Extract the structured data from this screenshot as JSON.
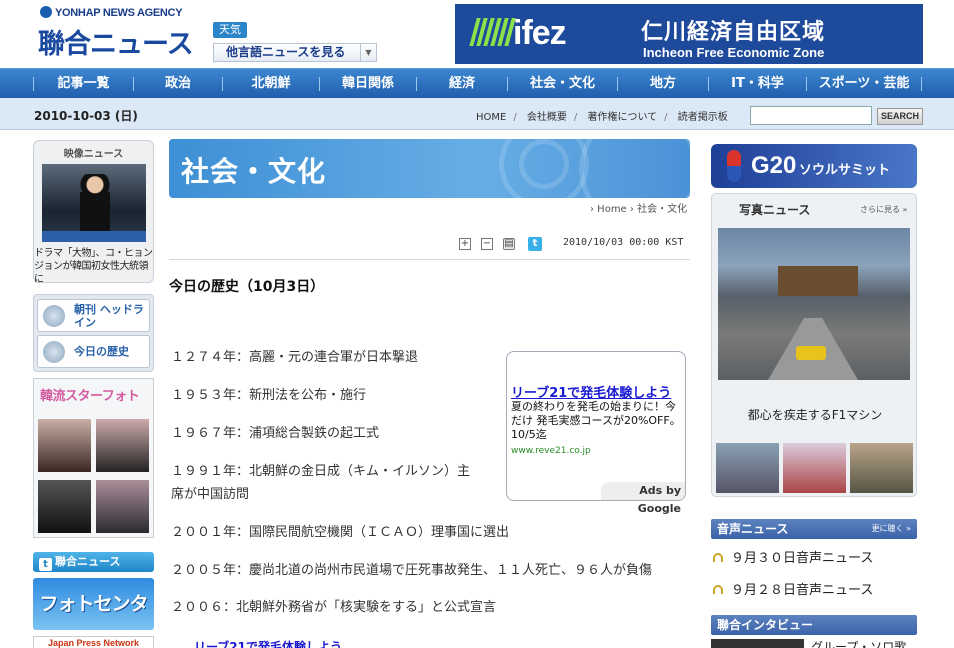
{
  "header": {
    "agency": "YONHAP NEWS AGENCY",
    "logo": "聯合ニュース",
    "weather": "天気",
    "lang_select": "他言語ニュースを見る",
    "banner": {
      "brand": "ifez",
      "ja": "仁川経済自由区域",
      "en": "Incheon Free Economic Zone"
    }
  },
  "nav": [
    "記事一覧",
    "政治",
    "北朝鮮",
    "韓日関係",
    "経済",
    "社会・文化",
    "地方",
    "IT・科学",
    "スポーツ・芸能"
  ],
  "subbar": {
    "date": "2010-10-03 (日)",
    "links": [
      "HOME",
      "会社概要",
      "著作権について",
      "読者掲示板"
    ],
    "search_button": "SEARCH"
  },
  "left": {
    "video_title": "映像ニュース",
    "video_caption": "ドラマ「大物」、コ・ヒョンジョンが韓国初女性大統領に",
    "menu": [
      "朝刊 ヘッドライン",
      "今日の歴史"
    ],
    "star_title": "韓流スターフォト",
    "twitter": "聯合ニュースTwitter",
    "photo_center": "フォトセンター",
    "jpn": "Japan Press Network"
  },
  "main": {
    "section": "社会・文化",
    "breadcrumb": "› Home › 社会・文化",
    "timestamp": "2010/10/03 00:00 KST",
    "title": "今日の歴史（10月3日）",
    "history": [
      "１２７４年：高麗・元の連合軍が日本撃退",
      "１９５３年：新刑法を公布・施行",
      "１９６７年：浦項総合製鉄の起工式",
      "１９９１年：北朝鮮の金日成（キム・イルソン）主",
      "席が中国訪問",
      "２００１年：国際民間航空機関（ＩＣＡＯ）理事国に選出",
      "２００５年：慶尚北道の尚州市民道場で圧死事故発生、１１人死亡、９６人が負傷",
      "２００６：北朝鮮外務省が「核実験をする」と公式宣言"
    ],
    "ad": {
      "headline": "リーブ21で発毛体験しよう",
      "desc": "夏の終わりを発毛の始まりに！今だけ 発毛実感コースが20%OFF。10/5迄",
      "url": "www.reve21.co.jp",
      "ads_by": "Ads by Google"
    },
    "ad_bottom": "リーブ21で発毛体験しよう"
  },
  "right": {
    "g20": {
      "title": "G20",
      "sub": "ソウルサミット"
    },
    "photo_title": "写真ニュース",
    "photo_more": "さらに見る »",
    "photo_caption": "都心を疾走するF1マシン",
    "audio_title": "音声ニュース",
    "audio_more": "更に聴く »",
    "audio_items": [
      "９月３０日音声ニュース",
      "９月２８日音声ニュース"
    ],
    "interview_title": "聯合インタビュー",
    "interview_text": "グループ・ソロ歌"
  }
}
